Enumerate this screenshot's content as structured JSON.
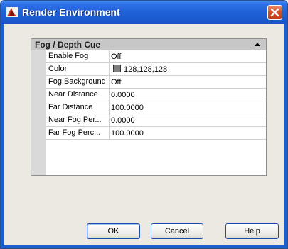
{
  "window": {
    "title": "Render Environment",
    "accent_color": "#1f5fd6",
    "icons": {
      "app": "render-app-icon",
      "close": "close-icon"
    }
  },
  "palette": {
    "category": "Fog / Depth Cue",
    "collapse_icon": "collapse-up-icon",
    "rows": [
      {
        "label": "Enable Fog",
        "value": "Off"
      },
      {
        "label": "Color",
        "value": "128,128,128",
        "swatch": "#808080"
      },
      {
        "label": "Fog Background",
        "value": "Off"
      },
      {
        "label": "Near Distance",
        "value": "0.0000"
      },
      {
        "label": "Far Distance",
        "value": "100.0000"
      },
      {
        "label": "Near Fog Per...",
        "value": "0.0000"
      },
      {
        "label": "Far Fog Perc...",
        "value": "100.0000"
      }
    ]
  },
  "buttons": {
    "ok": "OK",
    "cancel": "Cancel",
    "help": "Help"
  }
}
